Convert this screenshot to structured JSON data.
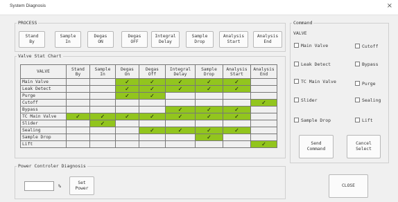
{
  "window": {
    "title": "System Diagnosis",
    "close_glyph": "×"
  },
  "process": {
    "legend": "PROCESS",
    "buttons": [
      {
        "label": "Stand\nBy"
      },
      {
        "label": "Sample\nIn"
      },
      {
        "label": "Degas\nON"
      },
      {
        "label": "Degas\nOFF"
      },
      {
        "label": "Integral\nDelay"
      },
      {
        "label": "Sample\nDrop"
      },
      {
        "label": "Analysis\nStart"
      },
      {
        "label": "Analysis\nEnd"
      }
    ]
  },
  "chart": {
    "legend": "Valve Stat Chart",
    "corner_header": "VALVE",
    "columns": [
      "Stand\nBy",
      "Sample\nIn",
      "Degas\nOn",
      "Degas\nOff",
      "Integral\nDelay",
      "Sample\nDrop",
      "Analysis\nStart",
      "Analysis\nEnd"
    ],
    "check_glyph": "✓",
    "rows": [
      {
        "label": "Main Valve",
        "cells": [
          0,
          0,
          1,
          1,
          1,
          1,
          1,
          0
        ]
      },
      {
        "label": "Leak Detect",
        "cells": [
          0,
          0,
          1,
          1,
          1,
          1,
          1,
          0
        ]
      },
      {
        "label": "Purge",
        "cells": [
          0,
          0,
          1,
          1,
          0,
          0,
          0,
          0
        ]
      },
      {
        "label": "Cutoff",
        "cells": [
          0,
          0,
          0,
          0,
          0,
          0,
          0,
          1
        ]
      },
      {
        "label": "Bypass",
        "cells": [
          0,
          0,
          0,
          0,
          1,
          1,
          1,
          0
        ]
      },
      {
        "label": "TC Main Valve",
        "cells": [
          1,
          1,
          1,
          1,
          1,
          1,
          1,
          0
        ]
      },
      {
        "label": "Slider",
        "cells": [
          0,
          1,
          0,
          0,
          0,
          0,
          0,
          0
        ]
      },
      {
        "label": "Sealing",
        "cells": [
          0,
          0,
          0,
          1,
          1,
          1,
          1,
          0
        ]
      },
      {
        "label": "Sample Drop",
        "cells": [
          0,
          0,
          0,
          0,
          0,
          1,
          0,
          0
        ]
      },
      {
        "label": "Lift",
        "cells": [
          0,
          0,
          0,
          0,
          0,
          0,
          0,
          1
        ]
      }
    ]
  },
  "power": {
    "legend": "Power Controler Diagnosis",
    "input_value": "",
    "unit": "%",
    "set_button": "Set\nPower"
  },
  "command": {
    "legend": "Command",
    "valve_header": "VALVE",
    "valves": [
      {
        "label": "Main Valve"
      },
      {
        "label": "Cutoff"
      },
      {
        "label": "Leak Detect"
      },
      {
        "label": "Bypass"
      },
      {
        "label": "TC Main Valve"
      },
      {
        "label": "Purge"
      },
      {
        "label": "Slider"
      },
      {
        "label": "Sealing"
      },
      {
        "label": "Sample Drop"
      },
      {
        "label": "Lift"
      }
    ],
    "send_button": "Send\nCommand",
    "cancel_button": "Cancel\nSelect",
    "close_button": "CLOSE"
  },
  "colors": {
    "active_cell": "#92c51e"
  }
}
